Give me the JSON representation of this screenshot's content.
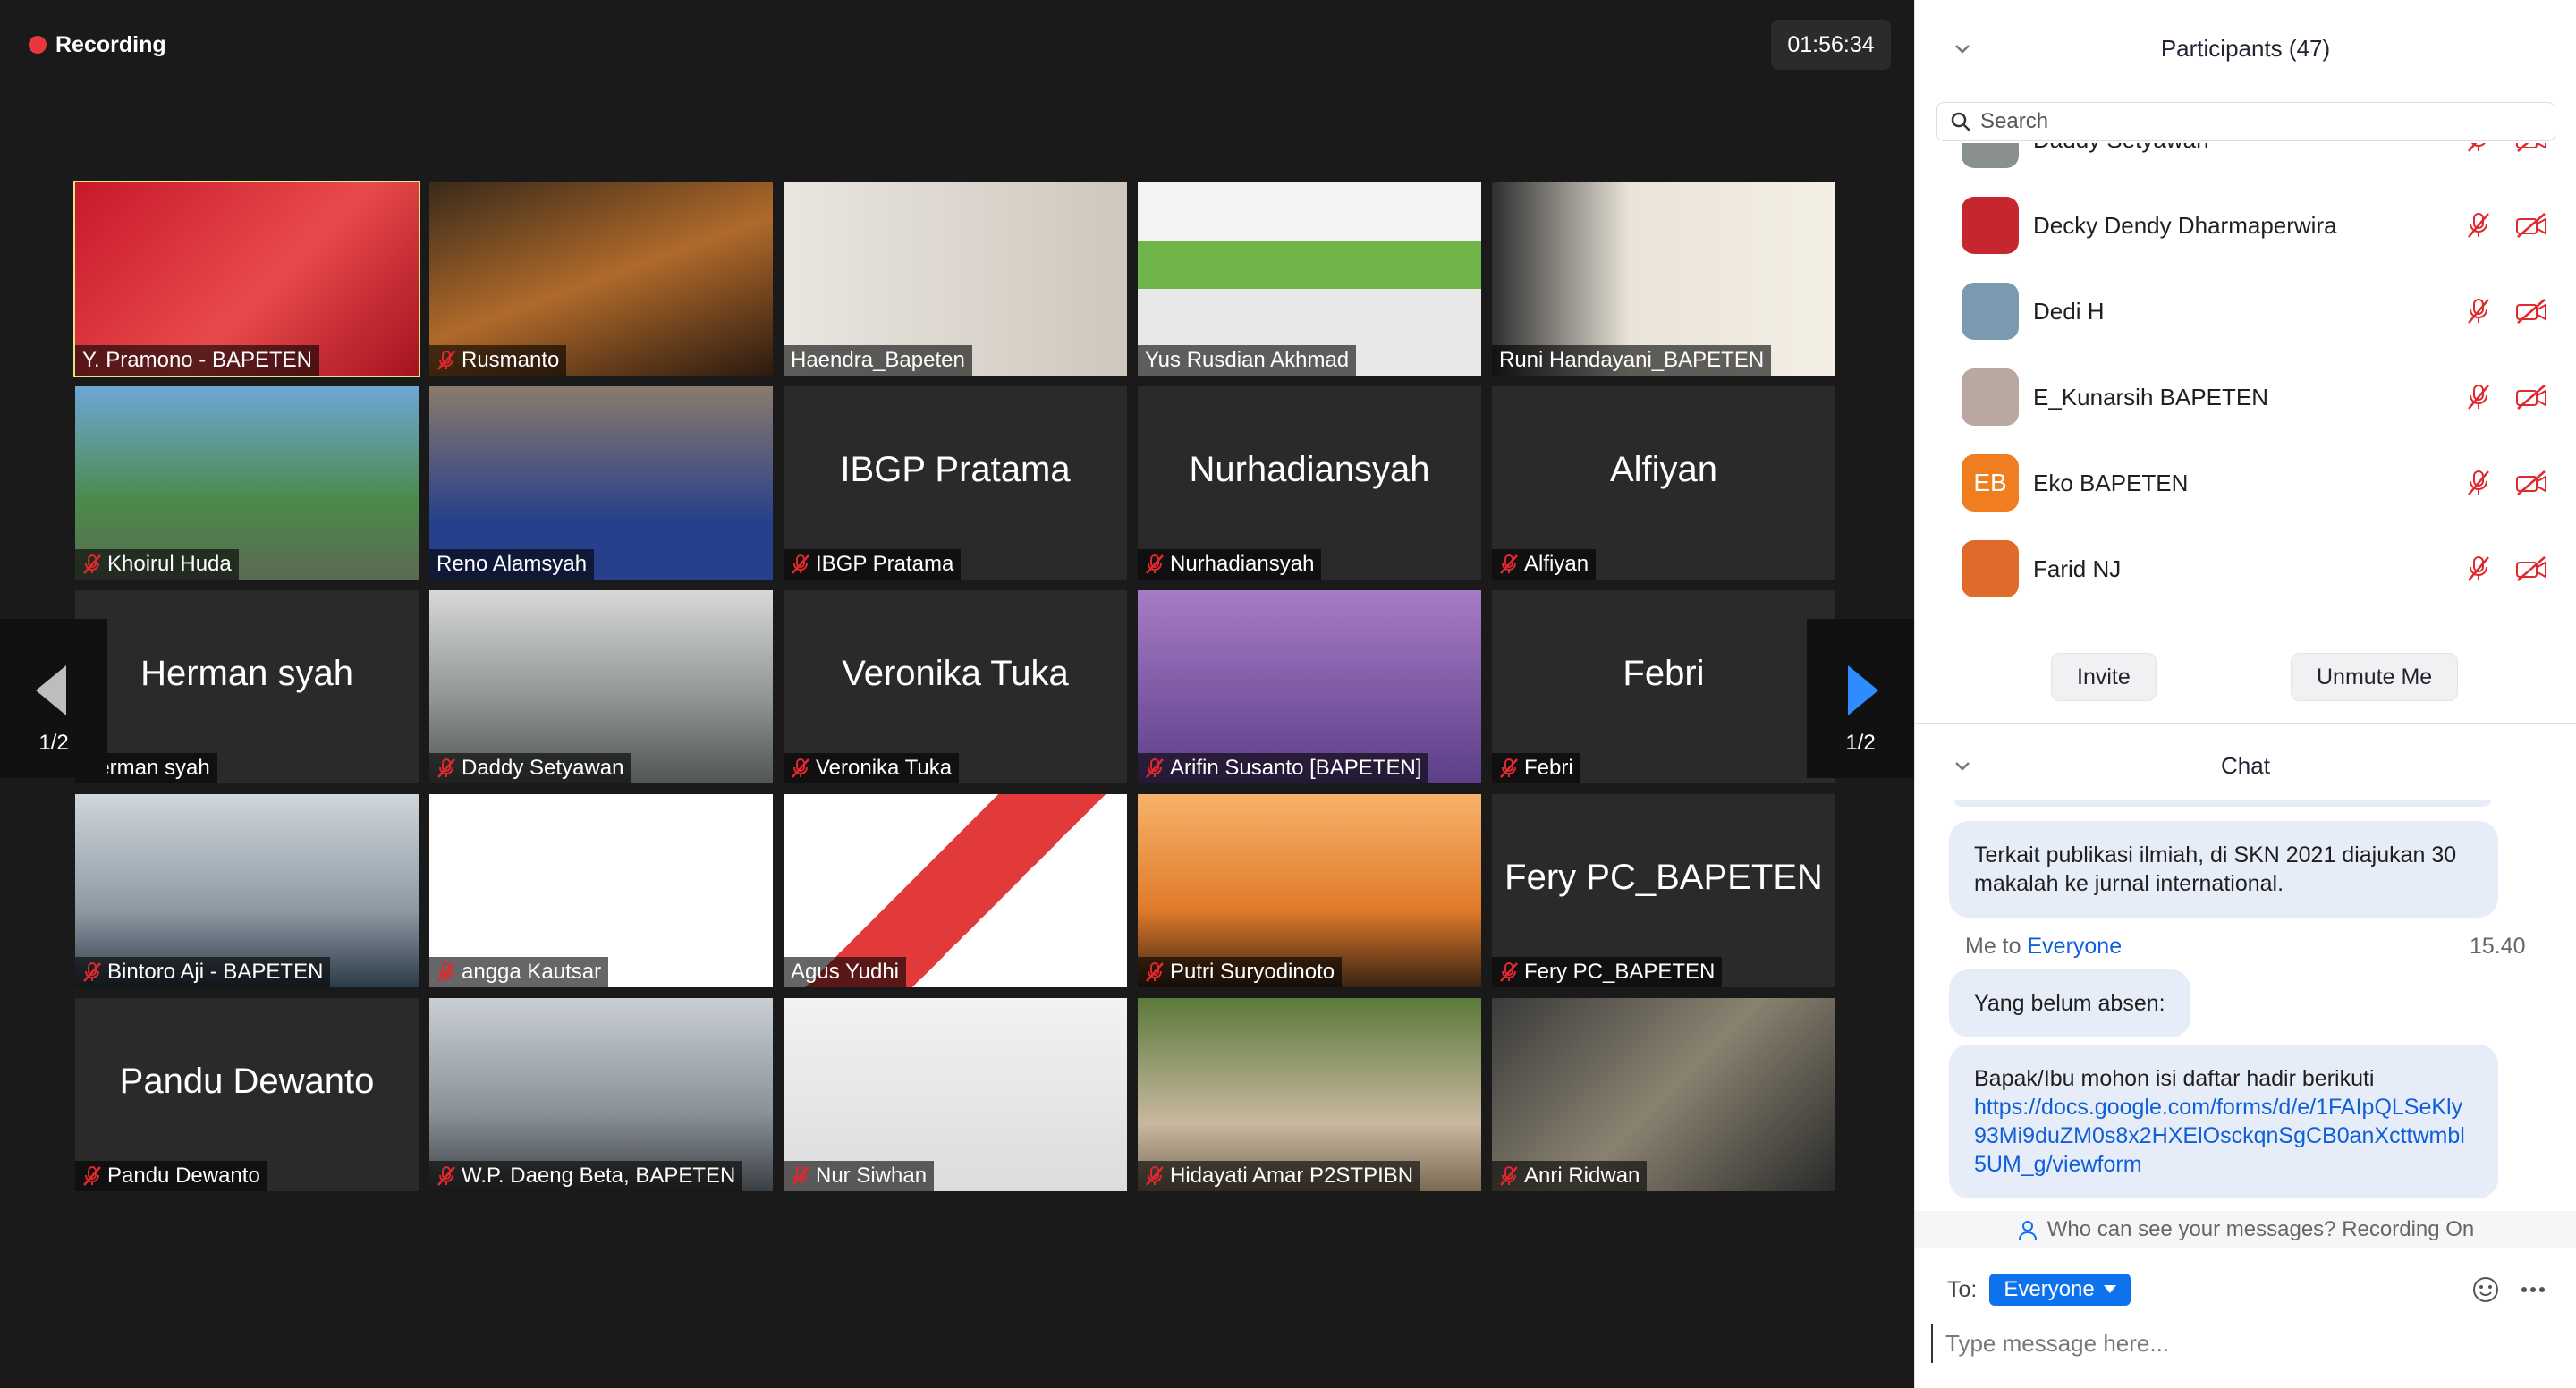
{
  "recording_label": "Recording",
  "timer": "01:56:34",
  "pagination": {
    "left": "1/2",
    "right": "1/2"
  },
  "tiles": [
    {
      "name": "Y. Pramono - BAPETEN",
      "big": "",
      "muted": false,
      "active": true,
      "bg": "linear-gradient(135deg,#c8182b,#e84a4a 55%,#a51220)"
    },
    {
      "name": "Rusmanto",
      "big": "",
      "muted": true,
      "active": false,
      "bg": "linear-gradient(160deg,#3a2a1a,#b06a2a 50%,#2b1a10)"
    },
    {
      "name": "Haendra_Bapeten",
      "big": "",
      "muted": false,
      "active": false,
      "bg": "linear-gradient(90deg,#e9e6e0,#cfc7bd)"
    },
    {
      "name": "Yus Rusdian Akhmad",
      "big": "",
      "muted": false,
      "active": false,
      "bg": "linear-gradient(180deg,#f3f3f3 30%,#6fb54a 30% 55%,#e8e8e8 55%)"
    },
    {
      "name": "Runi Handayani_BAPETEN",
      "big": "",
      "muted": false,
      "active": false,
      "bg": "linear-gradient(90deg,#2e2e2e,#e9e3d8 40%,#f4efe6)"
    },
    {
      "name": "Khoirul Huda",
      "big": "",
      "muted": true,
      "active": false,
      "bg": "linear-gradient(180deg,#6fa7d6,#4b8a4a 60%,#5a6a55)"
    },
    {
      "name": "Reno Alamsyah",
      "big": "",
      "muted": false,
      "active": false,
      "bg": "linear-gradient(180deg,#8a7a6a,#27408b 70%)"
    },
    {
      "name": "IBGP Pratama",
      "big": "IBGP Pratama",
      "muted": true,
      "active": false,
      "bg": ""
    },
    {
      "name": "Nurhadiansyah",
      "big": "Nurhadiansyah",
      "muted": true,
      "active": false,
      "bg": ""
    },
    {
      "name": "Alfiyan",
      "big": "Alfiyan",
      "muted": true,
      "active": false,
      "bg": ""
    },
    {
      "name": "Herman syah",
      "big": "Herman syah",
      "muted": false,
      "active": false,
      "bg": ""
    },
    {
      "name": "Daddy Setyawan",
      "big": "",
      "muted": true,
      "active": false,
      "bg": "linear-gradient(180deg,#d8d8d8,#8a9090 60%,#505555)"
    },
    {
      "name": "Veronika Tuka",
      "big": "Veronika Tuka",
      "muted": true,
      "active": false,
      "bg": ""
    },
    {
      "name": "Arifin Susanto [BAPETEN]",
      "big": "",
      "muted": true,
      "active": false,
      "bg": "linear-gradient(180deg,#a77bc6,#5b3f87)"
    },
    {
      "name": "Febri",
      "big": "Febri",
      "muted": true,
      "active": false,
      "bg": ""
    },
    {
      "name": "Bintoro Aji - BAPETEN",
      "big": "",
      "muted": true,
      "active": false,
      "bg": "linear-gradient(180deg,#cfd6dc,#8e9aa3 60%,#2d3a48)"
    },
    {
      "name": "angga Kautsar",
      "big": "",
      "muted": true,
      "active": false,
      "bg": "#ffffff"
    },
    {
      "name": "Agus Yudhi",
      "big": "",
      "muted": false,
      "active": false,
      "bg": "linear-gradient(135deg,#ffffff 40%,#e23a3a 40% 60%,#ffffff 60%)"
    },
    {
      "name": "Putri Suryodinoto",
      "big": "",
      "muted": true,
      "active": false,
      "bg": "linear-gradient(180deg,#f7b26a,#e07a2a 60%,#3a2412)"
    },
    {
      "name": "Fery PC_BAPETEN",
      "big": "Fery PC_BAPETEN",
      "muted": true,
      "active": false,
      "bg": ""
    },
    {
      "name": "Pandu Dewanto",
      "big": "Pandu Dewanto",
      "muted": true,
      "active": false,
      "bg": ""
    },
    {
      "name": "W.P. Daeng Beta, BAPETEN",
      "big": "",
      "muted": true,
      "active": false,
      "bg": "linear-gradient(180deg,#c9cfd4,#8a9196 60%,#3a3f44)"
    },
    {
      "name": "Nur Siwhan",
      "big": "",
      "muted": true,
      "active": false,
      "bg": "linear-gradient(180deg,#f2f2f2,#dcdcdc)"
    },
    {
      "name": "Hidayati Amar P2STPIBN",
      "big": "",
      "muted": true,
      "active": false,
      "bg": "linear-gradient(180deg,#5b7a3a,#c9b8a0 65%,#7a6a55)"
    },
    {
      "name": "Anri Ridwan",
      "big": "",
      "muted": true,
      "active": false,
      "bg": "linear-gradient(135deg,#3a3a3a,#8a8270 50%,#2a2a2a)"
    }
  ],
  "participants": {
    "title": "Participants (47)",
    "search_placeholder": "Search",
    "items": [
      {
        "name": "Daddy Setyawan",
        "avatar_text": "",
        "avatar_color": "#8a9090"
      },
      {
        "name": "Decky Dendy Dharmaperwira",
        "avatar_text": "",
        "avatar_color": "#c6262e"
      },
      {
        "name": "Dedi H",
        "avatar_text": "",
        "avatar_color": "#7a9ab0"
      },
      {
        "name": "E_Kunarsih BAPETEN",
        "avatar_text": "",
        "avatar_color": "#b8a8a0"
      },
      {
        "name": "Eko BAPETEN",
        "avatar_text": "EB",
        "avatar_color": "#f07d1f"
      },
      {
        "name": "Farid NJ",
        "avatar_text": "",
        "avatar_color": "#e06a2a"
      }
    ],
    "invite_label": "Invite",
    "unmute_label": "Unmute Me"
  },
  "chat": {
    "title": "Chat",
    "messages": [
      {
        "text": "Terkait publikasi ilmiah, di SKN 2021 diajukan 30 makalah ke jurnal international."
      },
      {
        "text": "Yang belum absen:"
      },
      {
        "text": "Bapak/Ibu mohon isi daftar hadir berikuti",
        "link": "https://docs.google.com/forms/d/e/1FAIpQLSeKly93Mi9duZM0s8x2HXElOsckqnSgCB0anXcttwmbl5UM_g/viewform"
      }
    ],
    "meta_sender": "Me to",
    "meta_recipient": "Everyone",
    "meta_time": "15.40",
    "who_can_see": "Who can see your messages? Recording On",
    "to_label": "To:",
    "to_value": "Everyone",
    "input_placeholder": "Type message here..."
  },
  "colors": {
    "accent": "#0e72ed",
    "recording": "#e8373e",
    "active_speaker": "#e5e680",
    "muted_icon": "#e0282e"
  }
}
